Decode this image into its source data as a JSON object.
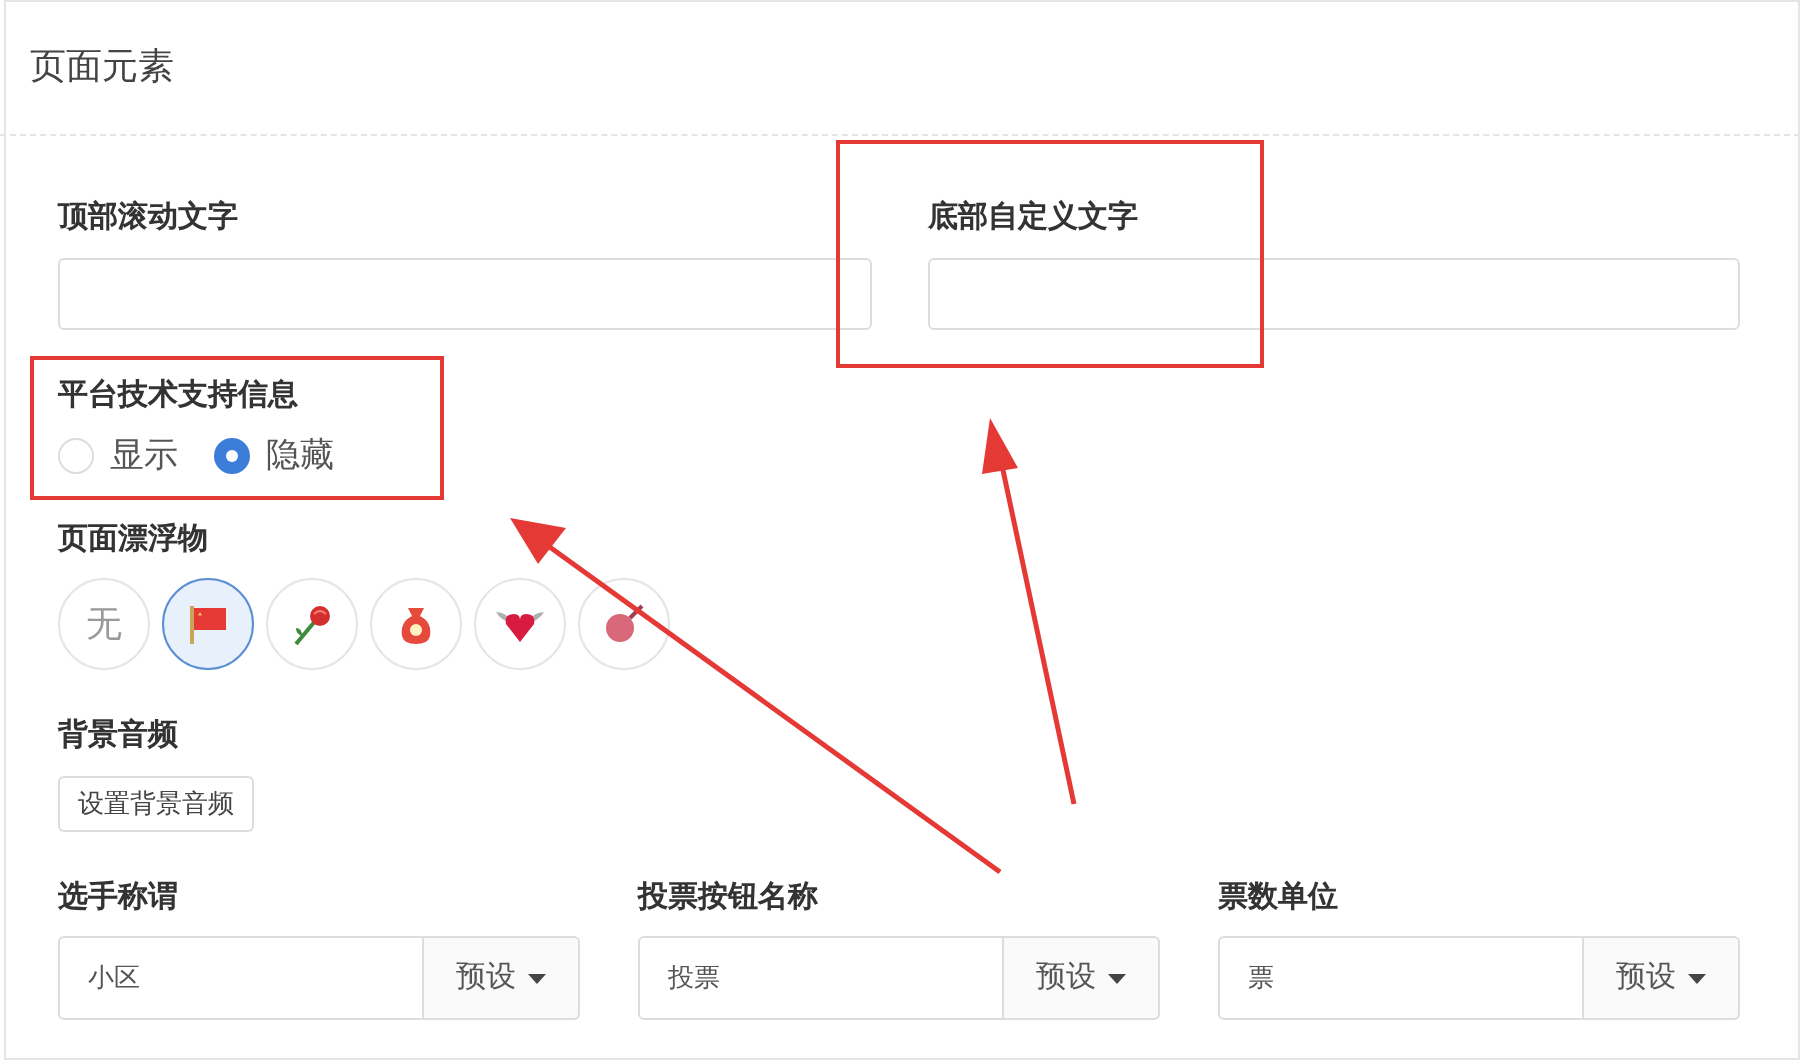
{
  "panel": {
    "title": "页面元素"
  },
  "top_scroll_text": {
    "label": "顶部滚动文字"
  },
  "bottom_custom_text": {
    "label": "底部自定义文字"
  },
  "platform_support_info": {
    "label": "平台技术支持信息",
    "options": [
      {
        "label": "显示",
        "selected": false
      },
      {
        "label": "隐藏",
        "selected": true
      }
    ]
  },
  "page_floater": {
    "label": "页面漂浮物",
    "items": [
      {
        "kind": "text",
        "label": "无",
        "selected": false
      },
      {
        "kind": "flag",
        "selected": true
      },
      {
        "kind": "rose",
        "selected": false
      },
      {
        "kind": "bag",
        "selected": false
      },
      {
        "kind": "heart",
        "selected": false
      },
      {
        "kind": "balloon",
        "selected": false
      }
    ]
  },
  "background_audio": {
    "label": "背景音频",
    "button": "设置背景音频"
  },
  "fields": [
    {
      "label": "选手称谓",
      "value": "小区",
      "preset": "预设"
    },
    {
      "label": "投票按钮名称",
      "value": "投票",
      "preset": "预设"
    },
    {
      "label": "票数单位",
      "value": "票",
      "preset": "预设"
    }
  ]
}
